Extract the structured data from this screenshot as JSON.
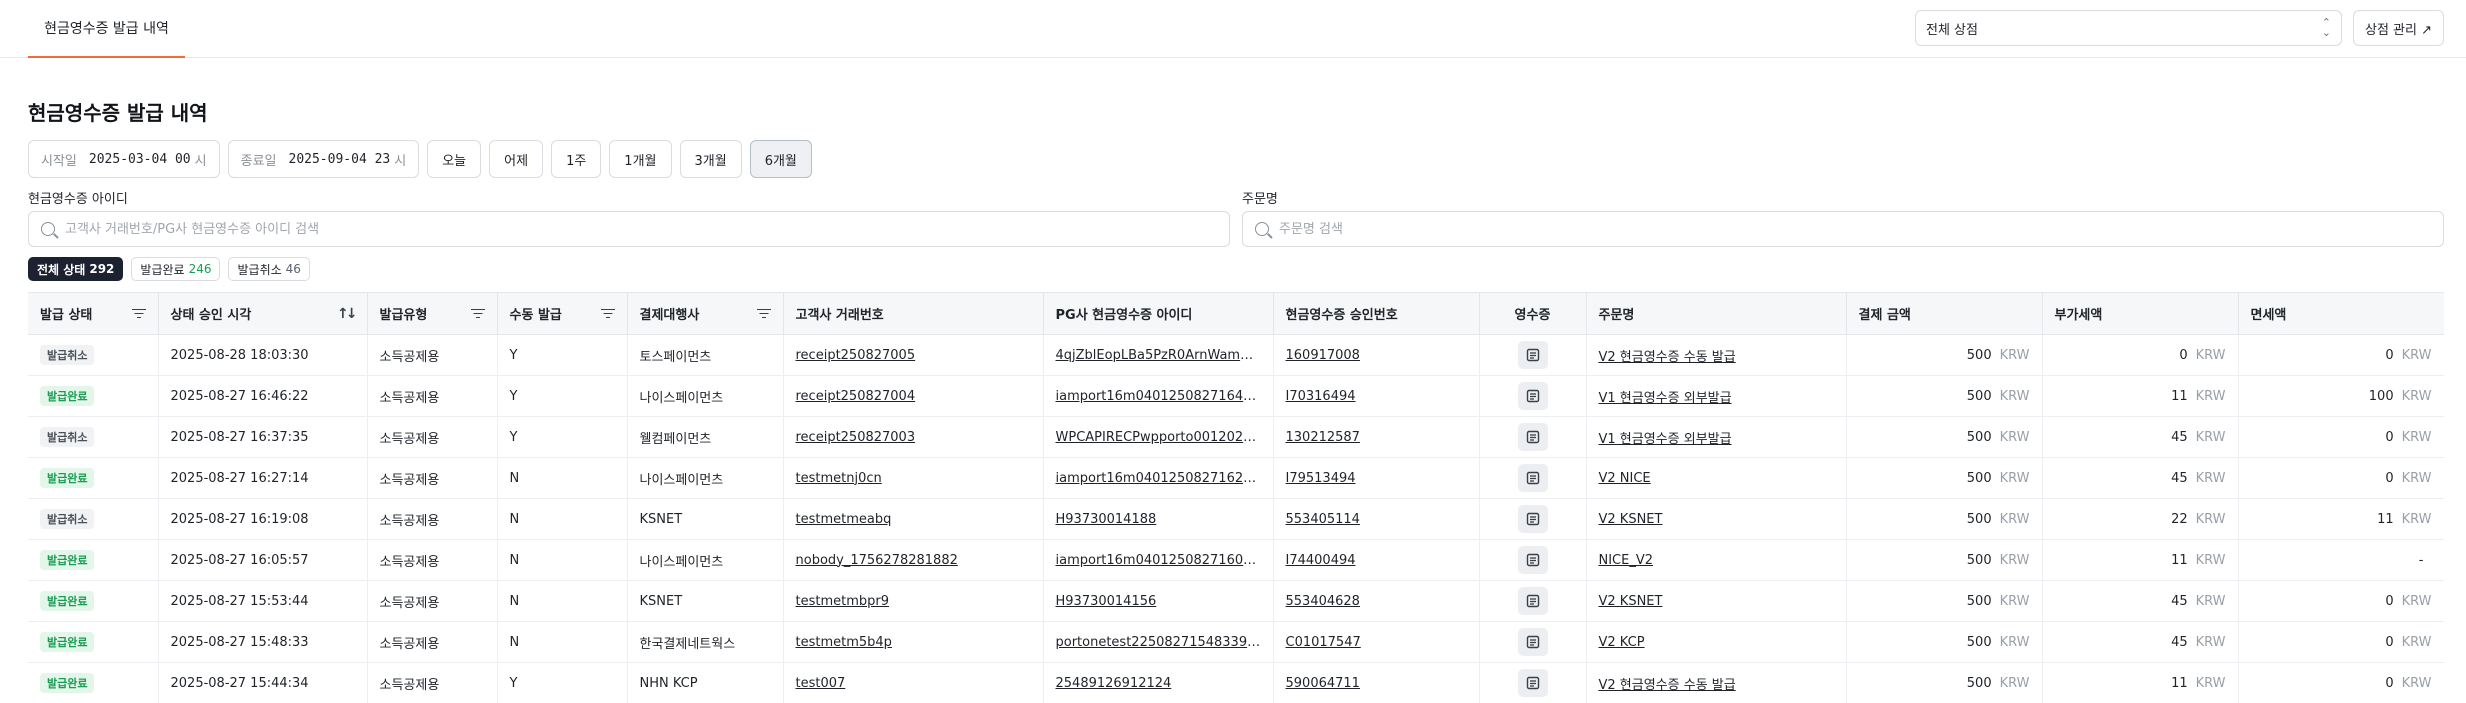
{
  "header": {
    "tab_label": "현금영수증 발급 내역",
    "store_select_value": "전체 상점",
    "store_manage_label": "상점 관리 ↗"
  },
  "page_title": "현금영수증 발급 내역",
  "date_filter": {
    "start_label": "시작일",
    "start_value": "2025-03-04 00",
    "start_unit": "시",
    "end_label": "종료일",
    "end_value": "2025-09-04 23",
    "end_unit": "시",
    "ranges": [
      "오늘",
      "어제",
      "1주",
      "1개월",
      "3개월",
      "6개월"
    ],
    "active_range": "6개월"
  },
  "search": {
    "receipt_id_label": "현금영수증 아이디",
    "receipt_id_placeholder": "고객사 거래번호/PG사 현금영수증 아이디 검색",
    "order_name_label": "주문명",
    "order_name_placeholder": "주문명 검색"
  },
  "status_chips": [
    {
      "label": "전체 상태",
      "count": "292"
    },
    {
      "label": "발급완료",
      "count": "246"
    },
    {
      "label": "발급취소",
      "count": "46"
    }
  ],
  "table": {
    "columns": [
      "발급 상태",
      "상태 승인 시각",
      "발급유형",
      "수동 발급",
      "결제대행사",
      "고객사 거래번호",
      "PG사 현금영수증 아이디",
      "현금영수증 승인번호",
      "영수증",
      "주문명",
      "결제 금액",
      "부가세액",
      "면세액"
    ],
    "currency": "KRW",
    "rows": [
      {
        "status": "발급취소",
        "time": "2025-08-28 18:03:30",
        "type": "소득공제용",
        "manual": "Y",
        "pg": "토스페이먼츠",
        "tx": "receipt250827005",
        "pg_id": "4qjZblEopLBa5PzR0ArnWamQXyM...",
        "approval": "160917008",
        "order": "V2 현금영수증 수동 발급",
        "amount": "500",
        "vat": "0",
        "taxfree": "0"
      },
      {
        "status": "발급완료",
        "time": "2025-08-27 16:46:22",
        "type": "소득공제용",
        "manual": "Y",
        "pg": "나이스페이먼츠",
        "tx": "receipt250827004",
        "pg_id": "iamport16m04012508271646227...",
        "approval": "I70316494",
        "order": "V1 현금영수증 외부발급",
        "amount": "500",
        "vat": "11",
        "taxfree": "100"
      },
      {
        "status": "발급취소",
        "time": "2025-08-27 16:37:35",
        "type": "소득공제용",
        "manual": "Y",
        "pg": "웰컴페이먼츠",
        "tx": "receipt250827003",
        "pg_id": "WPCAPIRECPwpporto001202508...",
        "approval": "130212587",
        "order": "V1 현금영수증 외부발급",
        "amount": "500",
        "vat": "45",
        "taxfree": "0"
      },
      {
        "status": "발급완료",
        "time": "2025-08-27 16:27:14",
        "type": "소득공제용",
        "manual": "N",
        "pg": "나이스페이먼츠",
        "tx": "testmetnj0cn",
        "pg_id": "iamport16m04012508271627141 7...",
        "approval": "I79513494",
        "order": "V2 NICE",
        "amount": "500",
        "vat": "45",
        "taxfree": "0"
      },
      {
        "status": "발급취소",
        "time": "2025-08-27 16:19:08",
        "type": "소득공제용",
        "manual": "N",
        "pg": "KSNET",
        "tx": "testmetmeabq",
        "pg_id": "H93730014188",
        "approval": "553405114",
        "order": "V2 KSNET",
        "amount": "500",
        "vat": "22",
        "taxfree": "11"
      },
      {
        "status": "발급완료",
        "time": "2025-08-27 16:05:57",
        "type": "소득공제용",
        "manual": "N",
        "pg": "나이스페이먼츠",
        "tx": "nobody_1756278281882",
        "pg_id": "iamport16m04012508271605581 1...",
        "approval": "I74400494",
        "order": "NICE_V2",
        "amount": "500",
        "vat": "11",
        "taxfree": "-"
      },
      {
        "status": "발급완료",
        "time": "2025-08-27 15:53:44",
        "type": "소득공제용",
        "manual": "N",
        "pg": "KSNET",
        "tx": "testmetmbpr9",
        "pg_id": "H93730014156",
        "approval": "553404628",
        "order": "V2 KSNET",
        "amount": "500",
        "vat": "45",
        "taxfree": "0"
      },
      {
        "status": "발급완료",
        "time": "2025-08-27 15:48:33",
        "type": "소득공제용",
        "manual": "N",
        "pg": "한국결제네트웍스",
        "tx": "testmetm5b4p",
        "pg_id": "portonetest22508271548339897...",
        "approval": "C01017547",
        "order": "V2 KCP",
        "amount": "500",
        "vat": "45",
        "taxfree": "0"
      },
      {
        "status": "발급완료",
        "time": "2025-08-27 15:44:34",
        "type": "소득공제용",
        "manual": "Y",
        "pg": "NHN KCP",
        "tx": "test007",
        "pg_id": "25489126912124",
        "approval": "590064711",
        "order": "V2 현금영수증 수동 발급",
        "amount": "500",
        "vat": "11",
        "taxfree": "0"
      }
    ]
  },
  "colors": {
    "accent_tab": "#f06a3c",
    "done_green": "#1a9c53",
    "active_chip": "#1c2230"
  }
}
